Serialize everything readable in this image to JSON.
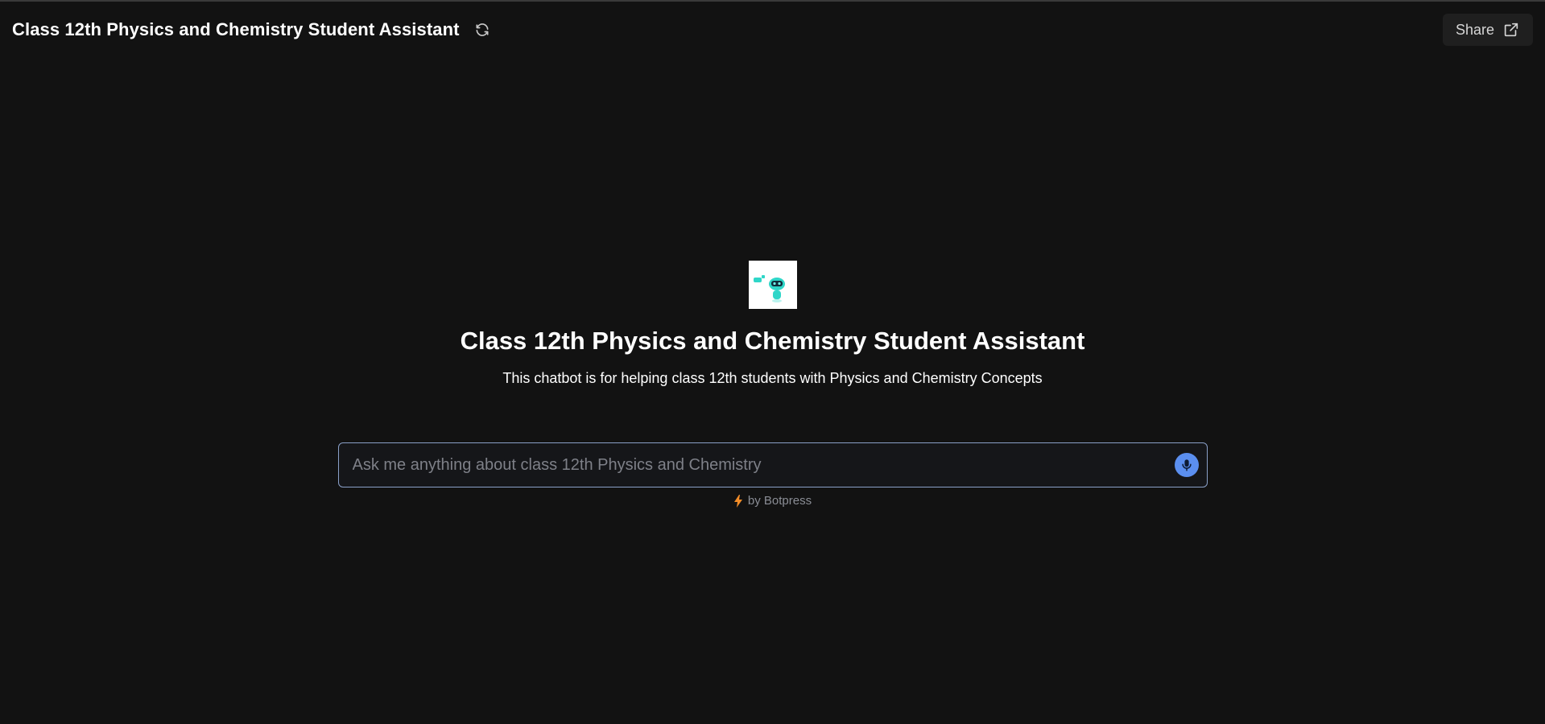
{
  "header": {
    "title": "Class 12th Physics and Chemistry Student Assistant",
    "refresh_icon": "refresh-icon",
    "share_label": "Share",
    "share_icon": "external-link-icon"
  },
  "bot": {
    "title": "Class 12th Physics and Chemistry Student Assistant",
    "description": "This chatbot is for helping class 12th students with Physics and Chemistry Concepts"
  },
  "composer": {
    "placeholder": "Ask me anything about class 12th Physics and Chemistry",
    "value": "",
    "mic_icon": "microphone-icon"
  },
  "footer": {
    "powered_by": "by Botpress",
    "bolt_icon": "lightning-icon"
  },
  "colors": {
    "background": "#121212",
    "accent": "#5b8ff0",
    "bolt": "#f28c28",
    "input_border": "#8aa0c8"
  }
}
